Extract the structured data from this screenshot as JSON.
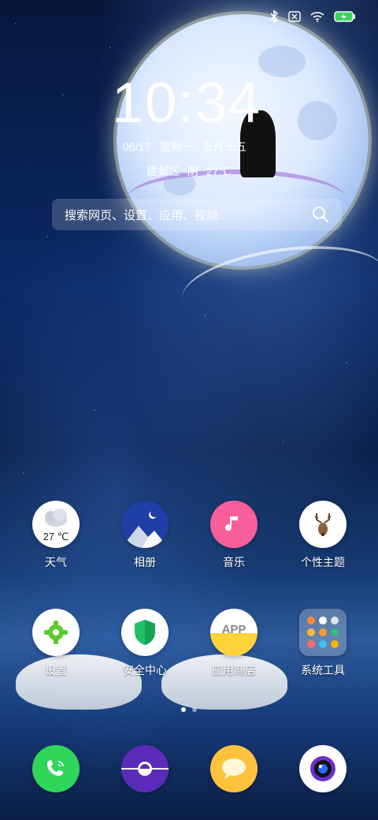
{
  "status_bar": {
    "icons": [
      "bluetooth-icon",
      "no-sim-icon",
      "wifi-icon",
      "battery-charging-icon"
    ]
  },
  "clock": {
    "time": "10:34",
    "date": "06/17",
    "weekday": "星期一",
    "lunar_date": "五月十五",
    "location": "建邺区",
    "condition": "阴",
    "temperature": "27℃"
  },
  "search": {
    "placeholder": "搜索网页、设置、应用、视频..."
  },
  "apps": [
    {
      "label": "天气",
      "icon": "weather-cloud-icon",
      "badge": "27 ℃"
    },
    {
      "label": "相册",
      "icon": "gallery-mountain-moon-icon"
    },
    {
      "label": "音乐",
      "icon": "music-note-icon"
    },
    {
      "label": "个性主题",
      "icon": "deer-theme-icon"
    },
    {
      "label": "设置",
      "icon": "settings-gear-icon"
    },
    {
      "label": "安全中心",
      "icon": "shield-icon"
    },
    {
      "label": "应用商店",
      "icon": "app-store-icon",
      "badge": "APP"
    },
    {
      "label": "系统工具",
      "icon": "folder-tools-icon"
    }
  ],
  "dock": [
    {
      "icon": "phone-icon",
      "color": "#2fd65a"
    },
    {
      "icon": "browser-icon",
      "color": "#5b2ab8"
    },
    {
      "icon": "messages-icon",
      "color": "#ffc23d"
    },
    {
      "icon": "camera-icon",
      "color": "#ffffff"
    }
  ],
  "pager": {
    "pages": 2,
    "active": 1
  }
}
